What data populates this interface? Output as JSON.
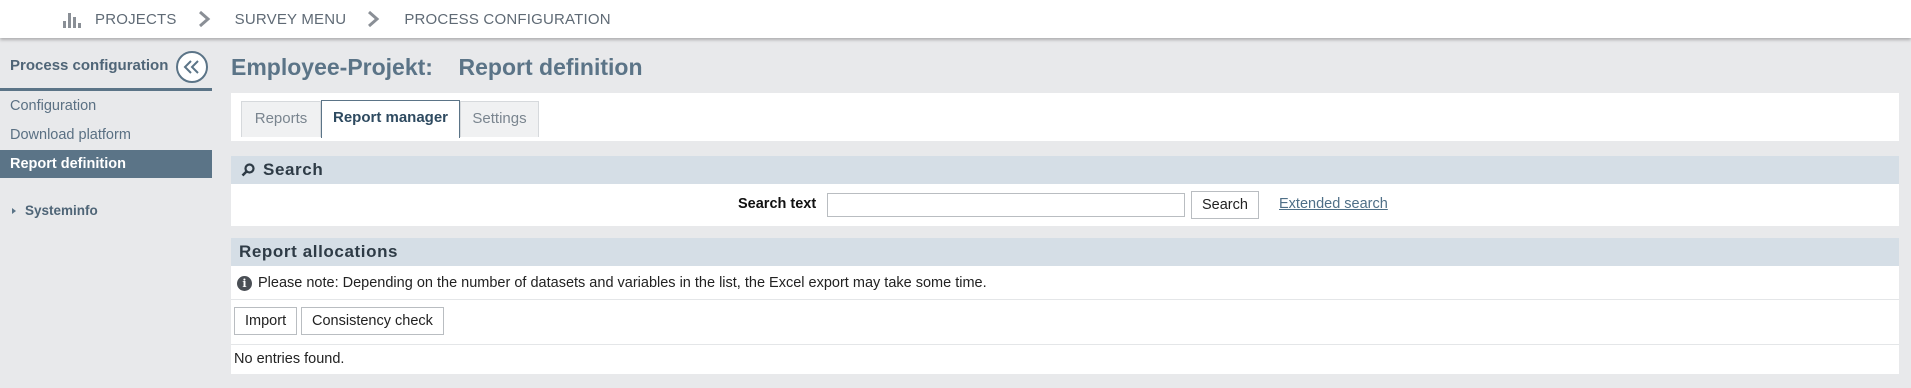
{
  "breadcrumb": {
    "items": [
      "PROJECTS",
      "SURVEY MENU",
      "PROCESS CONFIGURATION"
    ]
  },
  "sidebar": {
    "title": "Process configuration",
    "items": [
      {
        "label": "Configuration",
        "active": false
      },
      {
        "label": "Download platform",
        "active": false
      },
      {
        "label": "Report definition",
        "active": true
      }
    ],
    "systeminfo": "Systeminfo"
  },
  "main": {
    "project": "Employee-Projekt:",
    "title": "Report definition",
    "tabs": [
      {
        "label": "Reports",
        "active": false
      },
      {
        "label": "Report manager",
        "active": true
      },
      {
        "label": "Settings",
        "active": false
      }
    ]
  },
  "search": {
    "heading": "Search",
    "label": "Search text",
    "value": "",
    "button": "Search",
    "extended": "Extended search"
  },
  "allocations": {
    "heading": "Report allocations",
    "note": "Please note: Depending on the number of datasets and variables in the list, the Excel export may take some time.",
    "import_button": "Import",
    "consistency_button": "Consistency check",
    "empty": "No entries found."
  },
  "colors": {
    "accent": "#5b7487",
    "section_bg": "#d5dee6",
    "page_bg": "#e8e9eb",
    "link": "#4f6f87"
  },
  "icons": {
    "projects": "bar-chart-icon",
    "separator": "chevron-right-icon",
    "collapse": "double-chevron-left-icon",
    "search": "magnifier-icon",
    "info": "info-icon"
  }
}
